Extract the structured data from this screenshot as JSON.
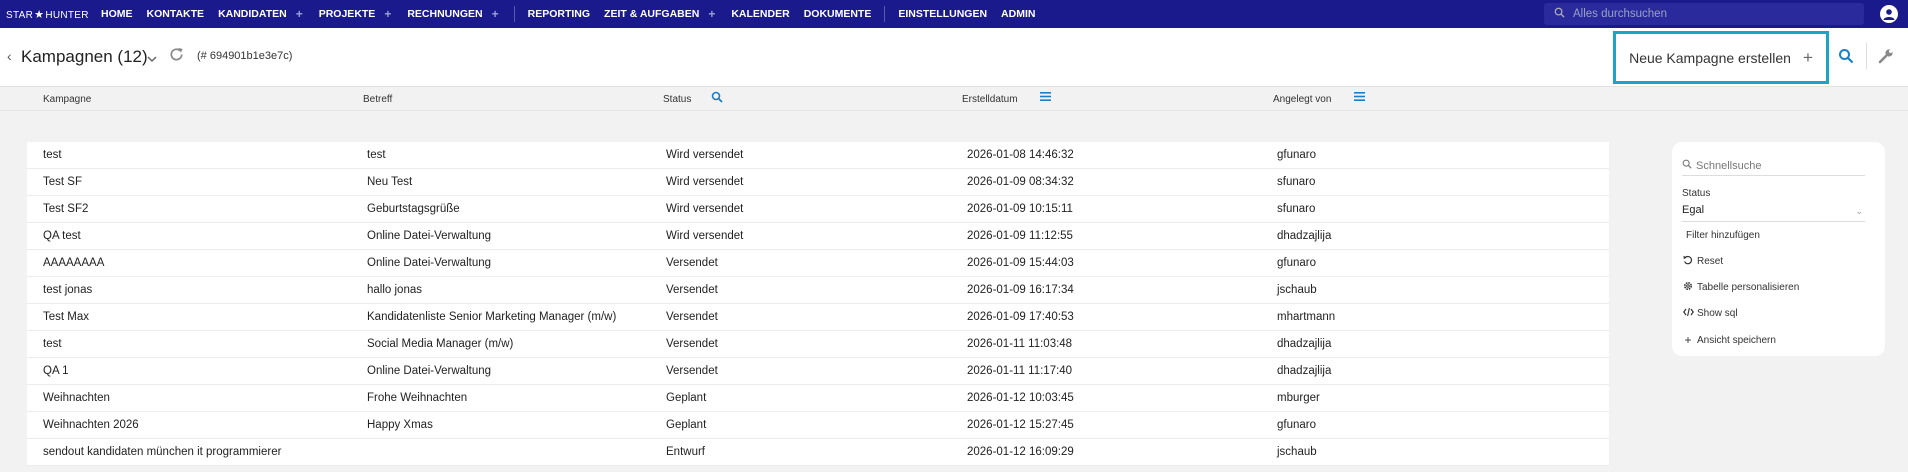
{
  "nav": {
    "logo": {
      "left": "STAR",
      "right": "HUNTER"
    },
    "items": [
      {
        "label": "HOME",
        "plus": false
      },
      {
        "label": "KONTAKTE",
        "plus": false
      },
      {
        "label": "KANDIDATEN",
        "plus": true
      },
      {
        "label": "PROJEKTE",
        "plus": true
      },
      {
        "label": "RECHNUNGEN",
        "plus": true
      },
      {
        "label": "REPORTING",
        "plus": false
      },
      {
        "label": "ZEIT & AUFGABEN",
        "plus": true
      },
      {
        "label": "KALENDER",
        "plus": false
      },
      {
        "label": "DOKUMENTE",
        "plus": false
      },
      {
        "label": "EINSTELLUNGEN",
        "plus": false
      },
      {
        "label": "ADMIN",
        "plus": false
      }
    ],
    "search_placeholder": "Alles durchsuchen"
  },
  "header": {
    "title": "Kampagnen (12)",
    "record_id": "(# 694901b1e3e7c)",
    "new_campaign_label": "Neue Kampagne erstellen",
    "new_campaign_plus": "+"
  },
  "columns": {
    "kampagne": "Kampagne",
    "betreff": "Betreff",
    "status": "Status",
    "erstelldatum": "Erstelldatum",
    "angelegt_von": "Angelegt von"
  },
  "rows": [
    {
      "kampagne": "test",
      "betreff": "test",
      "status": "Wird versendet",
      "datum": "2026-01-08 14:46:32",
      "von": "gfunaro"
    },
    {
      "kampagne": "Test SF",
      "betreff": "Neu Test",
      "status": "Wird versendet",
      "datum": "2026-01-09 08:34:32",
      "von": "sfunaro"
    },
    {
      "kampagne": "Test SF2",
      "betreff": "Geburtstagsgrüße",
      "status": "Wird versendet",
      "datum": "2026-01-09 10:15:11",
      "von": "sfunaro"
    },
    {
      "kampagne": "QA test",
      "betreff": "Online Datei-Verwaltung",
      "status": "Wird versendet",
      "datum": "2026-01-09 11:12:55",
      "von": "dhadzajlija"
    },
    {
      "kampagne": "AAAAAAAA",
      "betreff": "Online Datei-Verwaltung",
      "status": "Versendet",
      "datum": "2026-01-09 15:44:03",
      "von": "gfunaro"
    },
    {
      "kampagne": "test jonas",
      "betreff": "hallo jonas",
      "status": "Versendet",
      "datum": "2026-01-09 16:17:34",
      "von": "jschaub"
    },
    {
      "kampagne": "Test Max",
      "betreff": "Kandidatenliste Senior Marketing Manager (m/w)",
      "status": "Versendet",
      "datum": "2026-01-09 17:40:53",
      "von": "mhartmann"
    },
    {
      "kampagne": "test",
      "betreff": "Social Media Manager (m/w)",
      "status": "Versendet",
      "datum": "2026-01-11 11:03:48",
      "von": "dhadzajlija"
    },
    {
      "kampagne": "QA 1",
      "betreff": "Online Datei-Verwaltung",
      "status": "Versendet",
      "datum": "2026-01-11 11:17:40",
      "von": "dhadzajlija"
    },
    {
      "kampagne": "Weihnachten",
      "betreff": "Frohe Weihnachten",
      "status": "Geplant",
      "datum": "2026-01-12 10:03:45",
      "von": "mburger"
    },
    {
      "kampagne": "Weihnachten 2026",
      "betreff": "Happy Xmas",
      "status": "Geplant",
      "datum": "2026-01-12 15:27:45",
      "von": "gfunaro"
    },
    {
      "kampagne": "sendout kandidaten münchen it programmierer",
      "betreff": "",
      "status": "Entwurf",
      "datum": "2026-01-12 16:09:29",
      "von": "jschaub"
    }
  ],
  "filters": {
    "quicksearch_placeholder": "Schnellsuche",
    "status_label": "Status",
    "status_value": "Egal",
    "add_filter": "Filter hinzufügen",
    "reset": "Reset",
    "personalize": "Tabelle personalisieren",
    "show_sql": "Show sql",
    "save_view": "Ansicht speichern"
  },
  "colors": {
    "nav_bg": "#1a1a8c",
    "accent": "#1aa5c8",
    "icon_blue": "#1a7fc4"
  }
}
